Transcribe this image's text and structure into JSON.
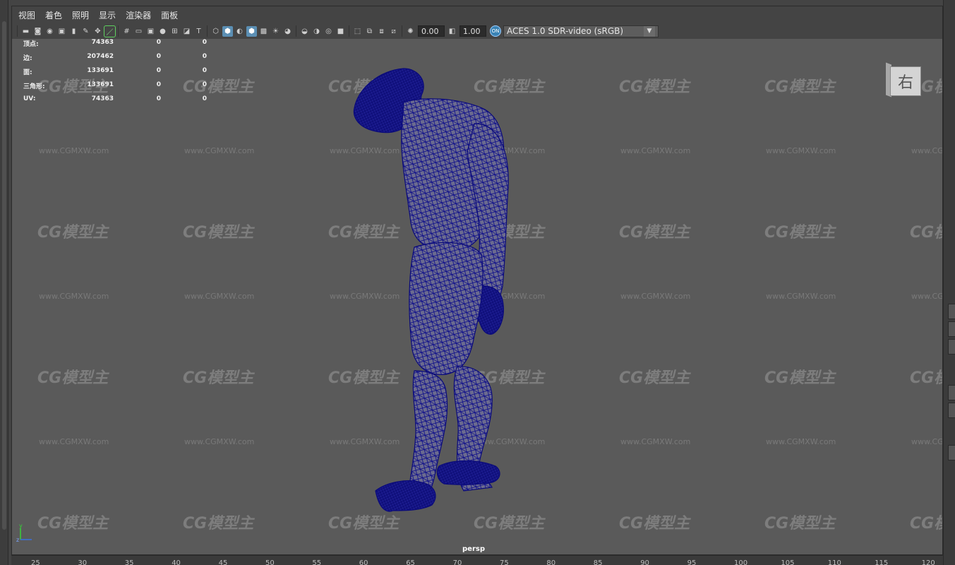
{
  "menu": [
    "视图",
    "着色",
    "照明",
    "显示",
    "渲染器",
    "面板"
  ],
  "toolbar": {
    "exposure_value": "0.00",
    "gamma_value": "1.00",
    "color_management_icon": "ON",
    "color_space": "ACES 1.0 SDR-video (sRGB)"
  },
  "hud": {
    "rows": [
      {
        "label": "顶点:",
        "v1": "74363",
        "v2": "0",
        "v3": "0"
      },
      {
        "label": "边:",
        "v1": "207462",
        "v2": "0",
        "v3": "0"
      },
      {
        "label": "面:",
        "v1": "133691",
        "v2": "0",
        "v3": "0"
      },
      {
        "label": "三角形:",
        "v1": "133691",
        "v2": "0",
        "v3": "0"
      },
      {
        "label": "UV:",
        "v1": "74363",
        "v2": "0",
        "v3": "0"
      }
    ]
  },
  "watermark": {
    "logo": "CG模型主",
    "url": "www.CGMXW.com"
  },
  "viewcube_label": "右",
  "camera_label": "persp",
  "axis_labels": {
    "y": "y",
    "z": "z"
  },
  "ruler": [
    "25",
    "30",
    "35",
    "40",
    "45",
    "50",
    "55",
    "60",
    "65",
    "70",
    "75",
    "80",
    "85",
    "90",
    "95",
    "100",
    "105",
    "110",
    "115",
    "120"
  ],
  "colors": {
    "wireframe": "#0a0a8c",
    "viewport_bg": "#5a5a5a",
    "accent": "#5b8fb4"
  }
}
